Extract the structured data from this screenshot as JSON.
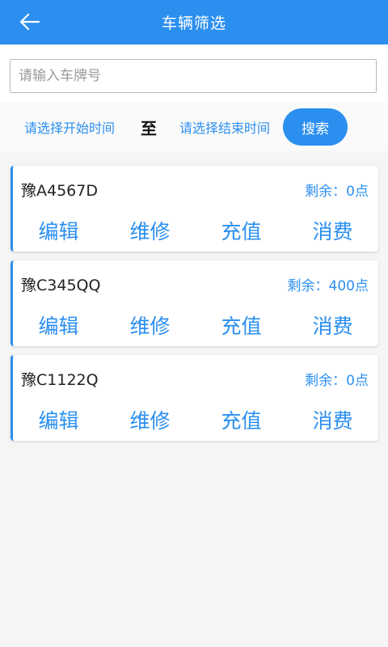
{
  "header": {
    "title": "车辆筛选"
  },
  "search": {
    "plate_placeholder": "请输入车牌号",
    "plate_value": "",
    "start_time_label": "请选择开始时间",
    "to_label": "至",
    "end_time_label": "请选择结束时间",
    "search_button_label": "搜索"
  },
  "vehicles": [
    {
      "plate": "豫A4567D",
      "balance": "剩余：0点",
      "actions": [
        "编辑",
        "维修",
        "充值",
        "消费"
      ]
    },
    {
      "plate": "豫C345QQ",
      "balance": "剩余：400点",
      "actions": [
        "编辑",
        "维修",
        "充值",
        "消费"
      ]
    },
    {
      "plate": "豫C1122Q",
      "balance": "剩余：0点",
      "actions": [
        "编辑",
        "维修",
        "充值",
        "消费"
      ]
    }
  ],
  "colors": {
    "accent": "#2b8ff0",
    "background": "#f5f5f5"
  }
}
